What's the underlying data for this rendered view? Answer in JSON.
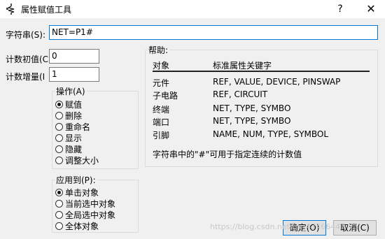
{
  "window": {
    "title": "属性赋值工具",
    "help_button": "?",
    "close_button": "✕",
    "icon_name": "resistor-tool-icon"
  },
  "string_field": {
    "label": "字符串(S):",
    "value": "NET=P1#"
  },
  "count_start": {
    "label": "计数初值(C",
    "value": "0"
  },
  "count_step": {
    "label": "计数增量(I",
    "value": "1"
  },
  "operation": {
    "title": "操作(A)",
    "options": [
      "赋值",
      "删除",
      "重命名",
      "显示",
      "隐藏",
      "调整大小"
    ],
    "selected": 0
  },
  "apply_to": {
    "title": "应用到(P):",
    "options": [
      "单击对象",
      "当前选中对象",
      "全局选中对象",
      "全体对象"
    ],
    "selected": 0
  },
  "help": {
    "title": "帮助:",
    "header": {
      "object": "对象",
      "keywords": "标准属性关键字"
    },
    "rows": [
      {
        "object": "元件",
        "keywords": "REF, VALUE, DEVICE, PINSWAP"
      },
      {
        "object": "子电路",
        "keywords": "REF, CIRCUIT"
      },
      {
        "object": "终端",
        "keywords": "NET, TYPE, SYMBO"
      },
      {
        "object": "端口",
        "keywords": "NET, TYPE, SYMBO"
      },
      {
        "object": "引脚",
        "keywords": "NAME, NUM, TYPE, SYMBOL"
      }
    ],
    "note": "字符串中的\"#\"可用于指定连续的计数值"
  },
  "buttons": {
    "ok": "确定(O)",
    "cancel": "取消(C)"
  },
  "watermark": "https://blog.csdn.net/qq_47466447"
}
